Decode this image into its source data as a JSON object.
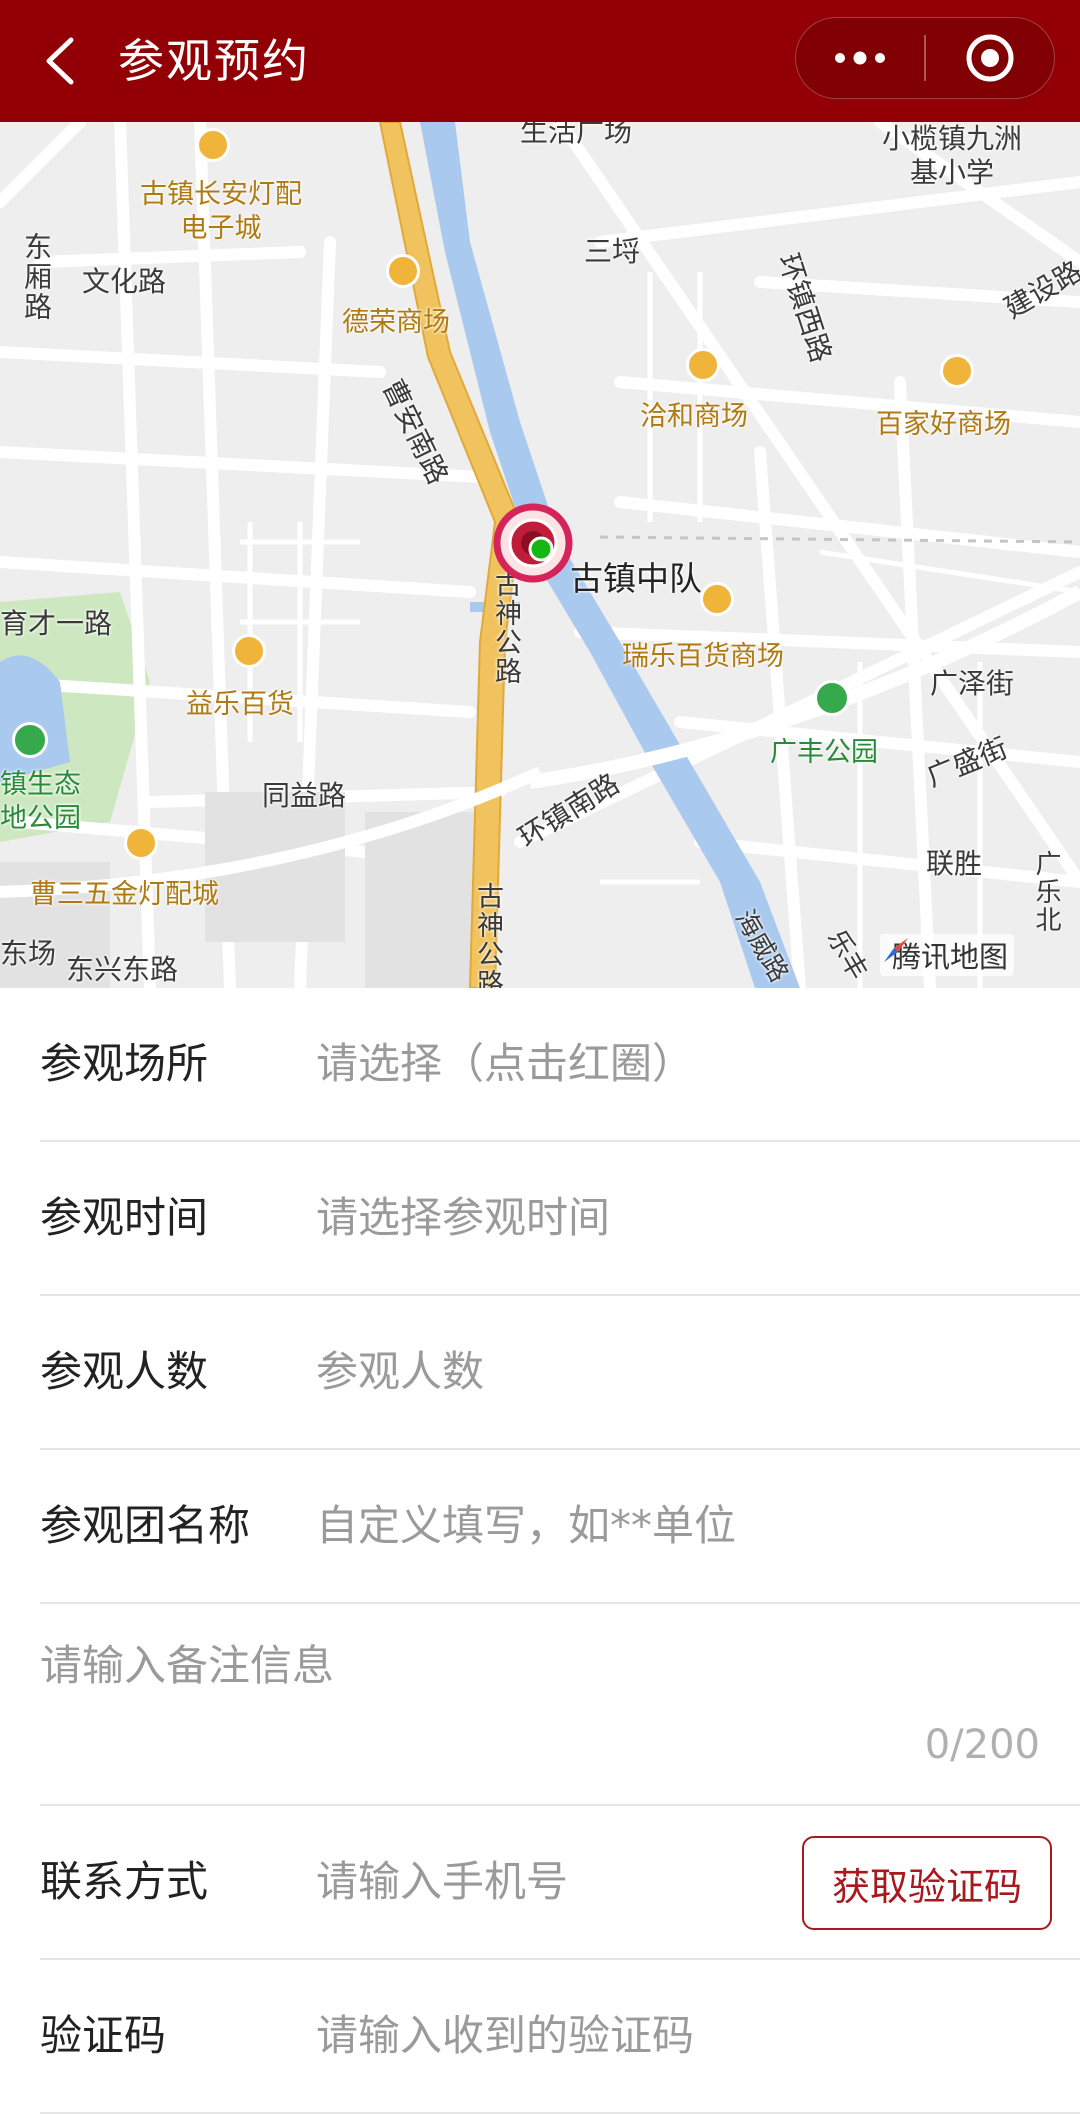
{
  "header": {
    "title": "参观预约",
    "back_icon": "chevron-left-icon",
    "more_icon": "more-dots-icon",
    "close_icon": "target-close-icon",
    "bg_color": "#920005"
  },
  "map": {
    "roads": [
      "东厢路",
      "文化路",
      "曹安南路",
      "育才一路",
      "同益路",
      "东兴东路",
      "古神公路",
      "环镇西路",
      "环镇南路",
      "建设路",
      "广泽街",
      "广盛街",
      "海威路",
      "乐丰",
      "广乐北"
    ],
    "pois": [
      "古镇长安灯配电子城",
      "德荣商场",
      "洽和商场",
      "百家好商场",
      "瑞乐百货商场",
      "益乐百货",
      "曹三五金灯配城",
      "小榄镇九洲基小学",
      "三埒",
      "联胜",
      "东场"
    ],
    "parks": [
      "广丰公园",
      "镇生态地公园"
    ],
    "highlight_label": "古镇中队",
    "top_partial": "生活广场",
    "watermark": "腾讯地图",
    "marker_icon": "location-target-icon"
  },
  "form": {
    "venue_label": "参观场所",
    "venue_placeholder": "请选择（点击红圈）",
    "time_label": "参观时间",
    "time_placeholder": "请选择参观时间",
    "people_label": "参观人数",
    "people_placeholder": "参观人数",
    "group_label": "参观团名称",
    "group_placeholder": "自定义填写，如**单位",
    "remark_placeholder": "请输入备注信息",
    "remark_counter": "0/200",
    "contact_label": "联系方式",
    "contact_placeholder": "请输入手机号",
    "get_code_button": "获取验证码",
    "code_label": "验证码",
    "code_placeholder": "请输入收到的验证码"
  },
  "colors": {
    "accent": "#a8181d",
    "river": "#a9c9ee",
    "main_road": "#f1c35e",
    "park": "#cde8c0"
  }
}
